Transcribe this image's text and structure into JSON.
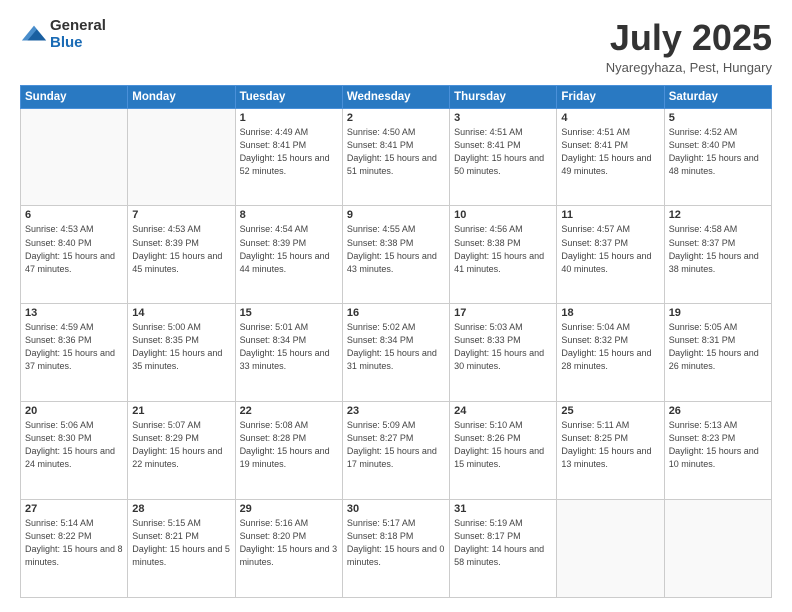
{
  "header": {
    "logo_general": "General",
    "logo_blue": "Blue",
    "month_title": "July 2025",
    "location": "Nyaregyhaza, Pest, Hungary"
  },
  "days_of_week": [
    "Sunday",
    "Monday",
    "Tuesday",
    "Wednesday",
    "Thursday",
    "Friday",
    "Saturday"
  ],
  "weeks": [
    [
      {
        "day": "",
        "sunrise": "",
        "sunset": "",
        "daylight": "",
        "empty": true
      },
      {
        "day": "",
        "sunrise": "",
        "sunset": "",
        "daylight": "",
        "empty": true
      },
      {
        "day": "1",
        "sunrise": "Sunrise: 4:49 AM",
        "sunset": "Sunset: 8:41 PM",
        "daylight": "Daylight: 15 hours and 52 minutes."
      },
      {
        "day": "2",
        "sunrise": "Sunrise: 4:50 AM",
        "sunset": "Sunset: 8:41 PM",
        "daylight": "Daylight: 15 hours and 51 minutes."
      },
      {
        "day": "3",
        "sunrise": "Sunrise: 4:51 AM",
        "sunset": "Sunset: 8:41 PM",
        "daylight": "Daylight: 15 hours and 50 minutes."
      },
      {
        "day": "4",
        "sunrise": "Sunrise: 4:51 AM",
        "sunset": "Sunset: 8:41 PM",
        "daylight": "Daylight: 15 hours and 49 minutes."
      },
      {
        "day": "5",
        "sunrise": "Sunrise: 4:52 AM",
        "sunset": "Sunset: 8:40 PM",
        "daylight": "Daylight: 15 hours and 48 minutes."
      }
    ],
    [
      {
        "day": "6",
        "sunrise": "Sunrise: 4:53 AM",
        "sunset": "Sunset: 8:40 PM",
        "daylight": "Daylight: 15 hours and 47 minutes."
      },
      {
        "day": "7",
        "sunrise": "Sunrise: 4:53 AM",
        "sunset": "Sunset: 8:39 PM",
        "daylight": "Daylight: 15 hours and 45 minutes."
      },
      {
        "day": "8",
        "sunrise": "Sunrise: 4:54 AM",
        "sunset": "Sunset: 8:39 PM",
        "daylight": "Daylight: 15 hours and 44 minutes."
      },
      {
        "day": "9",
        "sunrise": "Sunrise: 4:55 AM",
        "sunset": "Sunset: 8:38 PM",
        "daylight": "Daylight: 15 hours and 43 minutes."
      },
      {
        "day": "10",
        "sunrise": "Sunrise: 4:56 AM",
        "sunset": "Sunset: 8:38 PM",
        "daylight": "Daylight: 15 hours and 41 minutes."
      },
      {
        "day": "11",
        "sunrise": "Sunrise: 4:57 AM",
        "sunset": "Sunset: 8:37 PM",
        "daylight": "Daylight: 15 hours and 40 minutes."
      },
      {
        "day": "12",
        "sunrise": "Sunrise: 4:58 AM",
        "sunset": "Sunset: 8:37 PM",
        "daylight": "Daylight: 15 hours and 38 minutes."
      }
    ],
    [
      {
        "day": "13",
        "sunrise": "Sunrise: 4:59 AM",
        "sunset": "Sunset: 8:36 PM",
        "daylight": "Daylight: 15 hours and 37 minutes."
      },
      {
        "day": "14",
        "sunrise": "Sunrise: 5:00 AM",
        "sunset": "Sunset: 8:35 PM",
        "daylight": "Daylight: 15 hours and 35 minutes."
      },
      {
        "day": "15",
        "sunrise": "Sunrise: 5:01 AM",
        "sunset": "Sunset: 8:34 PM",
        "daylight": "Daylight: 15 hours and 33 minutes."
      },
      {
        "day": "16",
        "sunrise": "Sunrise: 5:02 AM",
        "sunset": "Sunset: 8:34 PM",
        "daylight": "Daylight: 15 hours and 31 minutes."
      },
      {
        "day": "17",
        "sunrise": "Sunrise: 5:03 AM",
        "sunset": "Sunset: 8:33 PM",
        "daylight": "Daylight: 15 hours and 30 minutes."
      },
      {
        "day": "18",
        "sunrise": "Sunrise: 5:04 AM",
        "sunset": "Sunset: 8:32 PM",
        "daylight": "Daylight: 15 hours and 28 minutes."
      },
      {
        "day": "19",
        "sunrise": "Sunrise: 5:05 AM",
        "sunset": "Sunset: 8:31 PM",
        "daylight": "Daylight: 15 hours and 26 minutes."
      }
    ],
    [
      {
        "day": "20",
        "sunrise": "Sunrise: 5:06 AM",
        "sunset": "Sunset: 8:30 PM",
        "daylight": "Daylight: 15 hours and 24 minutes."
      },
      {
        "day": "21",
        "sunrise": "Sunrise: 5:07 AM",
        "sunset": "Sunset: 8:29 PM",
        "daylight": "Daylight: 15 hours and 22 minutes."
      },
      {
        "day": "22",
        "sunrise": "Sunrise: 5:08 AM",
        "sunset": "Sunset: 8:28 PM",
        "daylight": "Daylight: 15 hours and 19 minutes."
      },
      {
        "day": "23",
        "sunrise": "Sunrise: 5:09 AM",
        "sunset": "Sunset: 8:27 PM",
        "daylight": "Daylight: 15 hours and 17 minutes."
      },
      {
        "day": "24",
        "sunrise": "Sunrise: 5:10 AM",
        "sunset": "Sunset: 8:26 PM",
        "daylight": "Daylight: 15 hours and 15 minutes."
      },
      {
        "day": "25",
        "sunrise": "Sunrise: 5:11 AM",
        "sunset": "Sunset: 8:25 PM",
        "daylight": "Daylight: 15 hours and 13 minutes."
      },
      {
        "day": "26",
        "sunrise": "Sunrise: 5:13 AM",
        "sunset": "Sunset: 8:23 PM",
        "daylight": "Daylight: 15 hours and 10 minutes."
      }
    ],
    [
      {
        "day": "27",
        "sunrise": "Sunrise: 5:14 AM",
        "sunset": "Sunset: 8:22 PM",
        "daylight": "Daylight: 15 hours and 8 minutes."
      },
      {
        "day": "28",
        "sunrise": "Sunrise: 5:15 AM",
        "sunset": "Sunset: 8:21 PM",
        "daylight": "Daylight: 15 hours and 5 minutes."
      },
      {
        "day": "29",
        "sunrise": "Sunrise: 5:16 AM",
        "sunset": "Sunset: 8:20 PM",
        "daylight": "Daylight: 15 hours and 3 minutes."
      },
      {
        "day": "30",
        "sunrise": "Sunrise: 5:17 AM",
        "sunset": "Sunset: 8:18 PM",
        "daylight": "Daylight: 15 hours and 0 minutes."
      },
      {
        "day": "31",
        "sunrise": "Sunrise: 5:19 AM",
        "sunset": "Sunset: 8:17 PM",
        "daylight": "Daylight: 14 hours and 58 minutes."
      },
      {
        "day": "",
        "sunrise": "",
        "sunset": "",
        "daylight": "",
        "empty": true
      },
      {
        "day": "",
        "sunrise": "",
        "sunset": "",
        "daylight": "",
        "empty": true
      }
    ]
  ]
}
